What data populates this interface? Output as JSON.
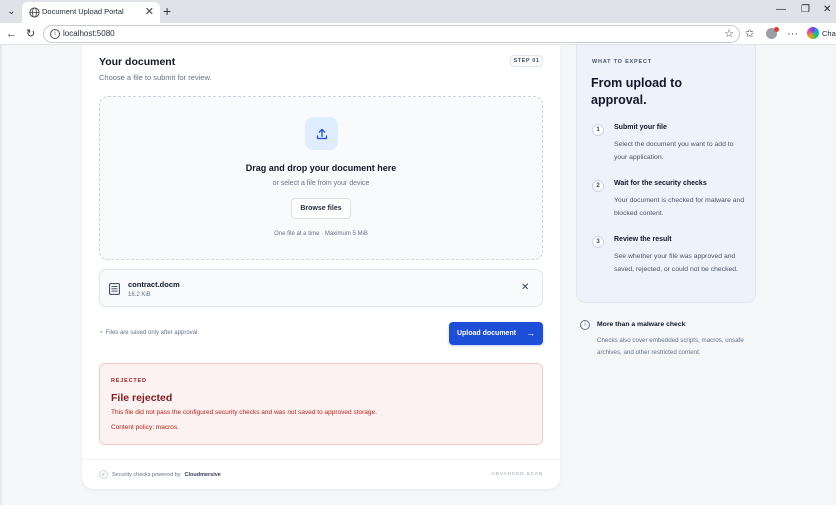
{
  "browser": {
    "tab_title": "Document Upload Portal",
    "url": "localhost:5080",
    "chat_label": "Chat"
  },
  "upload_card": {
    "title": "Your document",
    "subtitle": "Choose a file to submit for review.",
    "step_badge": "STEP 01",
    "dropzone": {
      "title": "Drag and drop your document here",
      "subtitle": "or select a file from your device",
      "browse_label": "Browse files",
      "limit_text": "One file at a time · Maximum 5 MiB"
    },
    "file": {
      "name": "contract.docm",
      "size": "16.2 KiB"
    },
    "save_note": "Files are saved only after approval.",
    "upload_label": "Upload document",
    "upload_arrow": "→",
    "alert": {
      "tag": "REJECTED",
      "title": "File rejected",
      "message": "This file did not pass the configured security checks and was not saved to approved storage.",
      "policy": "Content policy: macros."
    },
    "footer": {
      "powered_prefix": "Security checks powered by",
      "powered_brand": "Cloudmersive",
      "scan_label": "ADVANCED SCAN"
    }
  },
  "side_panel": {
    "tag": "WHAT TO EXPECT",
    "title": "From upload to approval.",
    "steps": [
      {
        "num": "1",
        "title": "Submit your file",
        "desc": "Select the document you want to add to your application."
      },
      {
        "num": "2",
        "title": "Wait for the security checks",
        "desc": "Your document is checked for malware and blocked content."
      },
      {
        "num": "3",
        "title": "Review the result",
        "desc": "See whether your file was approved and saved, rejected, or could not be checked."
      }
    ],
    "info": {
      "title": "More than a malware check",
      "desc": "Checks also cover embedded scripts, macros, unsafe archives, and other restricted content."
    }
  },
  "colors": {
    "primary": "#1d4ed8",
    "danger": "#b42318",
    "danger_bg": "#fdf2f2",
    "side_bg": "#eef3fb"
  },
  "icons": [
    "chevron-down-icon",
    "globe-icon",
    "close-icon",
    "plus-icon",
    "back-icon",
    "refresh-icon",
    "info-icon",
    "star-icon",
    "favorites-icon",
    "more-icon",
    "upload-icon",
    "document-icon",
    "arrow-right-icon",
    "check-icon"
  ]
}
